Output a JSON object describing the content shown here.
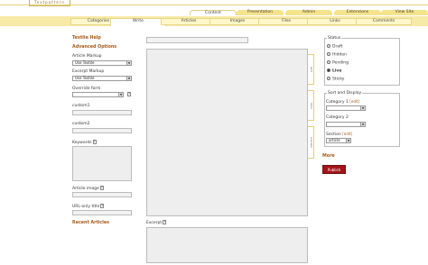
{
  "logo": "Textpattern",
  "top_tabs": [
    {
      "label": "Content",
      "active": true
    },
    {
      "label": "Presentation",
      "active": false
    },
    {
      "label": "Admin",
      "active": false
    },
    {
      "label": "Extensions",
      "active": false
    },
    {
      "label": "View Site",
      "active": false
    }
  ],
  "sub_tabs": [
    {
      "label": "Categories",
      "active": false
    },
    {
      "label": "Write",
      "active": true
    },
    {
      "label": "Articles",
      "active": false
    },
    {
      "label": "Images",
      "active": false
    },
    {
      "label": "Files",
      "active": false
    },
    {
      "label": "Links",
      "active": false
    },
    {
      "label": "Comments",
      "active": false
    }
  ],
  "left": {
    "textile_help": "Textile Help",
    "advanced_options": "Advanced Options",
    "article_markup_label": "Article Markup",
    "article_markup_value": "Use Textile",
    "excerpt_markup_label": "Excerpt Markup",
    "excerpt_markup_value": "Use Textile",
    "override_form_label": "Override form",
    "custom1": "custom1",
    "custom2": "custom2",
    "keywords": "Keywords",
    "article_image": "Article image",
    "url_title": "URL-only title",
    "recent_articles": "Recent Articles",
    "help": "?"
  },
  "center": {
    "excerpt_label": "Excerpt",
    "side_tabs": [
      "text",
      "html",
      "preview"
    ]
  },
  "right": {
    "status_legend": "Status",
    "statuses": [
      {
        "label": "Draft",
        "checked": false
      },
      {
        "label": "Hidden",
        "checked": false
      },
      {
        "label": "Pending",
        "checked": false
      },
      {
        "label": "Live",
        "checked": true
      },
      {
        "label": "Sticky",
        "checked": false
      }
    ],
    "sort_legend": "Sort and Display",
    "category1": "Category 1",
    "category2": "Category 2",
    "edit": "[edit]",
    "section": "Section",
    "section_value": "article",
    "more": "More",
    "publish": "Publish"
  }
}
